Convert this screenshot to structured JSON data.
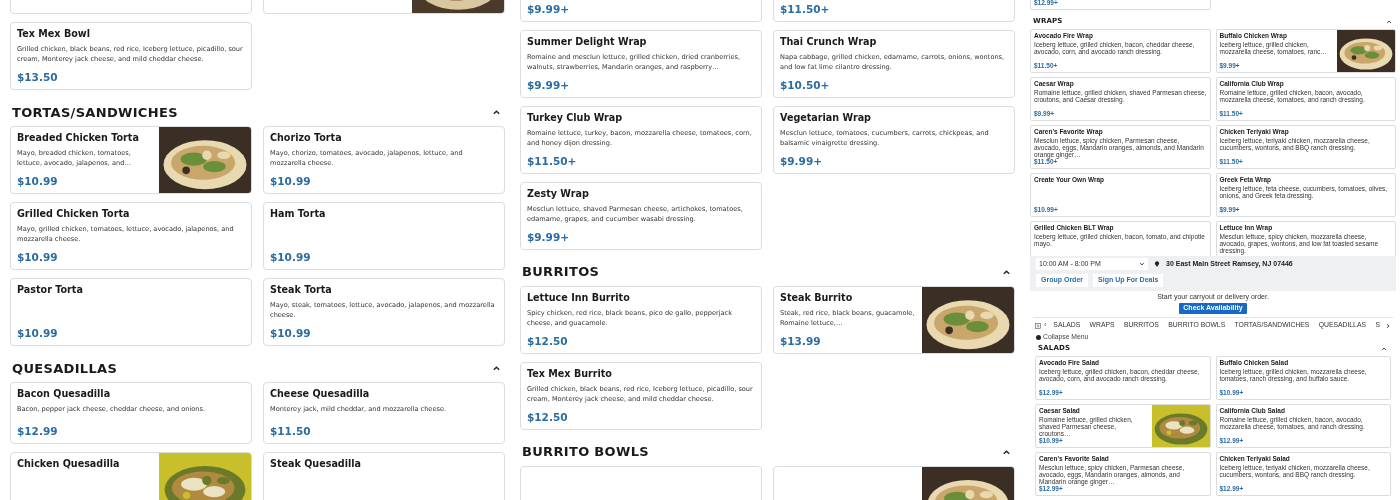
{
  "left_column": {
    "sections": [
      {
        "items": [
          {
            "has_image": false
          },
          {
            "has_image": true
          }
        ]
      },
      {
        "items": [
          {
            "name": "Tex Mex Bowl",
            "description": "Grilled chicken, black beans, red rice, Iceberg lettuce, picadillo, sour cream, Monterey jack cheese, and mild cheddar cheese.",
            "price": "$13.50",
            "has_image": false
          }
        ]
      },
      {
        "title": "TORTAS/SANDWICHES",
        "expanded": true,
        "items": [
          {
            "name": "Breaded Chicken Torta",
            "description": "Mayo, breaded chicken, tomatoes, lettuce, avocado, jalapenos, and…",
            "price": "$10.99",
            "has_image": true
          },
          {
            "name": "Chorizo Torta",
            "description": "Mayo, chorizo, tomatoes, avocado, jalapenos, lettuce, and mozzarella cheese.",
            "price": "$10.99",
            "has_image": false
          },
          {
            "name": "Grilled Chicken Torta",
            "description": "Mayo, grilled chicken, tomatoes, lettuce, avocado, jalapenos, and mozzarella cheese.",
            "price": "$10.99",
            "has_image": false
          },
          {
            "name": "Ham Torta",
            "price": "$10.99",
            "has_image": false
          },
          {
            "name": "Pastor Torta",
            "price": "$10.99",
            "has_image": false
          },
          {
            "name": "Steak Torta",
            "description": "Mayo, steak, tomatoes, lettuce, avocado, jalapenos, and mozzarella cheese.",
            "price": "$10.99",
            "has_image": false
          }
        ]
      },
      {
        "title": "QUESADILLAS",
        "expanded": true,
        "items": [
          {
            "name": "Bacon Quesadilla",
            "description": "Bacon, pepper jack cheese, cheddar cheese, and onions.",
            "price": "$12.99",
            "has_image": false
          },
          {
            "name": "Cheese Quesadilla",
            "description": "Monterey jack, mild cheddar, and mozzarella cheese.",
            "price": "$11.50",
            "has_image": false
          },
          {
            "name": "Chicken Quesadilla",
            "has_image": true
          },
          {
            "name": "Steak Quesadilla",
            "has_image": false
          }
        ]
      }
    ]
  },
  "middle_column": {
    "sections": [
      {
        "items": [
          {
            "price": "$9.99+",
            "has_image": false
          },
          {
            "price": "$11.50+",
            "has_image": false
          }
        ]
      },
      {
        "items": [
          {
            "name": "Summer Delight Wrap",
            "description": "Romaine and mesclun lettuce, grilled chicken, dried cranberries, walnuts, strawberries, Mandarin oranges, and raspberry…",
            "price": "$9.99+",
            "has_image": false
          },
          {
            "name": "Thai Crunch Wrap",
            "description": "Napa cabbage, grilled chicken, edamame, carrots, onions, wontons, and low fat lime cilantro dressing.",
            "price": "$10.50+",
            "has_image": false
          },
          {
            "name": "Turkey Club Wrap",
            "description": "Romaine lettuce, turkey, bacon, mozzarella cheese, tomatoes, corn, and honey dijon dressing.",
            "price": "$11.50+",
            "has_image": false
          },
          {
            "name": "Vegetarian Wrap",
            "description": "Mesclun lettuce, tomatoes, cucumbers, carrots, chickpeas, and balsamic vinaigrette dressing.",
            "price": "$9.99+",
            "has_image": false
          },
          {
            "name": "Zesty Wrap",
            "description": "Mesclun lettuce, shaved Parmesan cheese, artichokes, tomatoes, edamame, grapes, and cucumber wasabi dressing.",
            "price": "$9.99+",
            "has_image": false
          }
        ]
      },
      {
        "title": "BURRITOS",
        "expanded": true,
        "items": [
          {
            "name": "Lettuce Inn Burrito",
            "description": "Spicy chicken, red rice, black beans, pico de gallo, pepperjack cheese, and guacamole.",
            "price": "$12.50",
            "has_image": false
          },
          {
            "name": "Steak Burrito",
            "description": "Steak, red rice, black beans, guacamole, Romaine lettuce,…",
            "price": "$13.99",
            "has_image": true
          },
          {
            "name": "Tex Mex Burrito",
            "description": "Grilled chicken, black beans, red rice, Iceberg lettuce, picadillo, sour cream, Monterey jack cheese, and mild cheddar cheese.",
            "price": "$12.50",
            "has_image": false
          }
        ]
      },
      {
        "title": "BURRITO BOWLS",
        "expanded": true,
        "items": [
          {
            "has_image": false
          },
          {
            "has_image": true
          }
        ]
      }
    ]
  },
  "preview": {
    "top_sections": [
      {
        "items": [
          {
            "price": "$12.99+",
            "has_image": false
          }
        ]
      },
      {
        "title": "WRAPS",
        "expanded": true,
        "items": [
          {
            "name": "Avocado Fire Wrap",
            "description": "Iceberg lettuce, grilled chicken, bacon, cheddar cheese, avocado, corn, and avocado ranch dressing.",
            "price": "$11.50+",
            "has_image": false
          },
          {
            "name": "Buffalo Chicken Wrap",
            "description": "Iceberg lettuce, grilled chicken, mozzarella cheese, tomatoes, ranc…",
            "price": "$9.99+",
            "has_image": true
          },
          {
            "name": "Caesar Wrap",
            "description": "Romaine lettuce, grilled chicken, shaved Parmesan cheese, croutons, and Caesar dressing.",
            "price": "$9.99+",
            "has_image": false
          },
          {
            "name": "California Club Wrap",
            "description": "Romaine lettuce, grilled chicken, bacon, avocado, mozzarella cheese, tomatoes, and ranch dressing.",
            "price": "$11.50+",
            "has_image": false
          },
          {
            "name": "Caren's Favorite Wrap",
            "description": "Mesclun lettuce, spicy chicken, Parmesan cheese, avocado, eggs, Mandarin oranges, almonds, and Mandarin orange ginger…",
            "price": "$11.50+",
            "has_image": false
          },
          {
            "name": "Chicken Teriyaki Wrap",
            "description": "Iceberg lettuce, teriyaki chicken, mozzarella cheese, cucumbers, wontons, and BBQ ranch dressing.",
            "price": "$11.50+",
            "has_image": false
          },
          {
            "name": "Create Your Own Wrap",
            "price": "$10.99+",
            "has_image": false
          },
          {
            "name": "Greek Feta Wrap",
            "description": "Iceberg lettuce, feta cheese, cucumbers, tomatoes, olives, onions, and Greek feta dressing.",
            "price": "$9.99+",
            "has_image": false
          },
          {
            "name": "Grilled Chicken BLT Wrap",
            "description": "Iceberg lettuce, grilled chicken, bacon, tomato, and chipotle mayo.",
            "has_image": false
          },
          {
            "name": "Lettuce Inn Wrap",
            "description": "Mesclun lettuce, spicy chicken, mozzarella cheese, avocado, grapes, wontons, and low fat toasted sesame dressing.",
            "has_image": false
          }
        ]
      }
    ],
    "header": {
      "hours": "10:00 AM - 8:00 PM",
      "address": "30 East Main Street Ramsey, NJ 07446",
      "buttons": [
        "Group Order",
        "Sign Up For Deals"
      ]
    },
    "order_prompt": "Start your carryout or delivery order.",
    "check_button": "Check Availability",
    "nav_prev": "‹",
    "categories": [
      "SALADS",
      "WRAPS",
      "BURRITOS",
      "BURRITO BOWLS",
      "TORTAS/SANDWICHES",
      "QUESADILLAS",
      "S"
    ],
    "collapse_label": "Collapse Menu",
    "bottom_sections": [
      {
        "title": "SALADS",
        "expanded": true,
        "items": [
          {
            "name": "Avocado Fire Salad",
            "description": "Iceberg lettuce, grilled chicken, bacon, cheddar cheese, avocado, corn, and avocado ranch dressing.",
            "price": "$12.99+",
            "has_image": false
          },
          {
            "name": "Buffalo Chicken Salad",
            "description": "Iceberg lettuce, grilled chicken, mozzarella cheese, tomatoes, ranch dressing, and buffalo sauce.",
            "price": "$10.99+",
            "has_image": false
          },
          {
            "name": "Caesar Salad",
            "description": "Romaine lettuce, grilled chicken, shaved Parmesan cheese, croutons…",
            "price": "$10.99+",
            "has_image": true
          },
          {
            "name": "California Club Salad",
            "description": "Romaine lettuce, grilled chicken, bacon, avocado, mozzarella cheese, tomatoes, and ranch dressing.",
            "price": "$12.99+",
            "has_image": false
          },
          {
            "name": "Caren's Favorite Salad",
            "description": "Mesclun lettuce, spicy chicken, Parmesan cheese, avocado, eggs, Mandarin oranges, almonds, and Mandarin orange ginger…",
            "price": "$12.99+",
            "has_image": false
          },
          {
            "name": "Chicken Teriyaki Salad",
            "description": "Iceberg lettuce, teriyaki chicken, mozzarella cheese, cucumbers, wontons, and BBQ ranch dressing.",
            "price": "$12.99+",
            "has_image": false
          }
        ]
      }
    ]
  }
}
